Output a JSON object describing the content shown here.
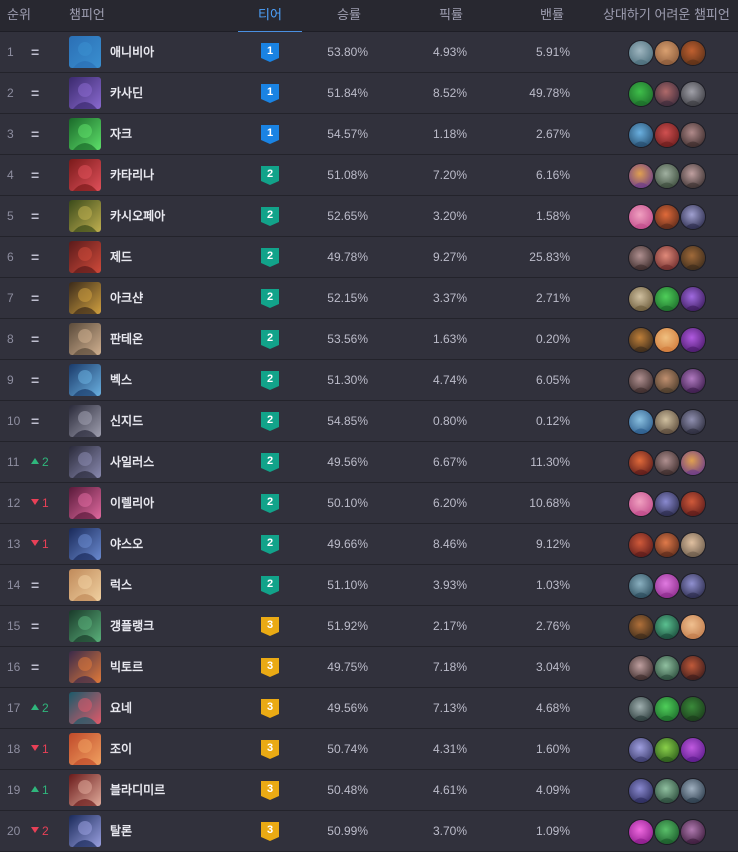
{
  "header": {
    "rank": "순위",
    "champion": "챔피언",
    "tier": "티어",
    "win_rate": "승률",
    "pick_rate": "픽률",
    "ban_rate": "밴률",
    "counters": "상대하기 어려운 챔피언"
  },
  "colors": {
    "tier1": "#1a83e3",
    "tier2": "#12a38a",
    "tier3": "#eaaa14",
    "up": "#2fb67c",
    "down": "#e84057",
    "active_tab": "#4a90e2"
  },
  "rows": [
    {
      "rank": "1",
      "change_dir": "same",
      "change": "=",
      "name": "애니비아",
      "tier": "1",
      "win": "53.80%",
      "pick": "4.93%",
      "ban": "5.91%",
      "c": [
        "#2b6fb5",
        "#3a8fd0"
      ],
      "counters": [
        [
          "#4a6c7a",
          "#9fb6c0"
        ],
        [
          "#8a5a3a",
          "#d9a070"
        ],
        [
          "#5a3018",
          "#c06030"
        ]
      ]
    },
    {
      "rank": "2",
      "change_dir": "same",
      "change": "=",
      "name": "카사딘",
      "tier": "1",
      "win": "51.84%",
      "pick": "8.52%",
      "ban": "49.78%",
      "c": [
        "#3b2a6e",
        "#8a6ad0"
      ],
      "counters": [
        [
          "#1c6a2a",
          "#3fbf4a"
        ],
        [
          "#3a2a3a",
          "#b06a6a"
        ],
        [
          "#3a3a40",
          "#a0a0a8"
        ]
      ]
    },
    {
      "rank": "3",
      "change_dir": "same",
      "change": "=",
      "name": "자크",
      "tier": "1",
      "win": "54.57%",
      "pick": "1.18%",
      "ban": "2.67%",
      "c": [
        "#1a6a2a",
        "#5ee06a"
      ],
      "counters": [
        [
          "#244a6a",
          "#6ab0e0"
        ],
        [
          "#6a1c1c",
          "#d05050"
        ],
        [
          "#3a2a2a",
          "#b08a8a"
        ]
      ]
    },
    {
      "rank": "4",
      "change_dir": "same",
      "change": "=",
      "name": "카타리나",
      "tier": "2",
      "win": "51.08%",
      "pick": "7.20%",
      "ban": "6.16%",
      "c": [
        "#7a1a1a",
        "#e0505a"
      ],
      "counters": [
        [
          "#6a3a8a",
          "#e0a050"
        ],
        [
          "#3a4a3a",
          "#a0b0a0"
        ],
        [
          "#3a3030",
          "#c0a0a0"
        ]
      ]
    },
    {
      "rank": "5",
      "change_dir": "same",
      "change": "=",
      "name": "카시오페아",
      "tier": "2",
      "win": "52.65%",
      "pick": "3.20%",
      "ban": "1.58%",
      "c": [
        "#3a4a1a",
        "#c0b050"
      ],
      "counters": [
        [
          "#c04a8a",
          "#f0a0c0"
        ],
        [
          "#5a2a1a",
          "#e06a3a"
        ],
        [
          "#2a2a4a",
          "#a0a0d0"
        ]
      ]
    },
    {
      "rank": "6",
      "change_dir": "same",
      "change": "=",
      "name": "제드",
      "tier": "2",
      "win": "49.78%",
      "pick": "9.27%",
      "ban": "25.83%",
      "c": [
        "#5a1a1a",
        "#d04a3a"
      ],
      "counters": [
        [
          "#3a2a2a",
          "#b09090"
        ],
        [
          "#6a2a2a",
          "#e08a7a"
        ],
        [
          "#3a2a1a",
          "#a06a3a"
        ]
      ]
    },
    {
      "rank": "7",
      "change_dir": "same",
      "change": "=",
      "name": "아크샨",
      "tier": "2",
      "win": "52.15%",
      "pick": "3.37%",
      "ban": "2.71%",
      "c": [
        "#3a2a1a",
        "#d0a040"
      ],
      "counters": [
        [
          "#6a5a3a",
          "#d0c0a0"
        ],
        [
          "#1c6a2a",
          "#4fcf5a"
        ],
        [
          "#3a1a5a",
          "#a06ae0"
        ]
      ]
    },
    {
      "rank": "8",
      "change_dir": "same",
      "change": "=",
      "name": "판테온",
      "tier": "2",
      "win": "53.56%",
      "pick": "1.63%",
      "ban": "0.20%",
      "c": [
        "#5a4a3a",
        "#d0b090"
      ],
      "counters": [
        [
          "#3a2a1a",
          "#c0803a"
        ],
        [
          "#d07a3a",
          "#f0c080"
        ],
        [
          "#4a1a6a",
          "#b05ae0"
        ]
      ]
    },
    {
      "rank": "9",
      "change_dir": "same",
      "change": "=",
      "name": "벡스",
      "tier": "2",
      "win": "51.30%",
      "pick": "4.74%",
      "ban": "6.05%",
      "c": [
        "#1a3a6a",
        "#6ab0e0"
      ],
      "counters": [
        [
          "#3a2a2a",
          "#b09090"
        ],
        [
          "#4a3a2a",
          "#c09070"
        ],
        [
          "#3a1a4a",
          "#b07ac0"
        ]
      ]
    },
    {
      "rank": "10",
      "change_dir": "same",
      "change": "=",
      "name": "신지드",
      "tier": "2",
      "win": "54.85%",
      "pick": "0.80%",
      "ban": "0.12%",
      "c": [
        "#2a2a3a",
        "#a0a0b0"
      ],
      "counters": [
        [
          "#2a5a8a",
          "#8ac0e0"
        ],
        [
          "#5a4a3a",
          "#d0c0a0"
        ],
        [
          "#2a2a3a",
          "#9090b0"
        ]
      ]
    },
    {
      "rank": "11",
      "change_dir": "up",
      "change": "2",
      "name": "사일러스",
      "tier": "2",
      "win": "49.56%",
      "pick": "6.67%",
      "ban": "11.30%",
      "c": [
        "#2a2a3a",
        "#8a8ab0"
      ],
      "counters": [
        [
          "#5a1a1a",
          "#e06a3a"
        ],
        [
          "#3a2a2a",
          "#b09090"
        ],
        [
          "#6a3a8a",
          "#e0a050"
        ]
      ]
    },
    {
      "rank": "12",
      "change_dir": "down",
      "change": "1",
      "name": "이렐리아",
      "tier": "2",
      "win": "50.10%",
      "pick": "6.20%",
      "ban": "10.68%",
      "c": [
        "#5a1a3a",
        "#e06aa0"
      ],
      "counters": [
        [
          "#c04a8a",
          "#f0a0c0"
        ],
        [
          "#2a2a4a",
          "#8a8ad0"
        ],
        [
          "#5a1a1a",
          "#d05a3a"
        ]
      ]
    },
    {
      "rank": "13",
      "change_dir": "down",
      "change": "1",
      "name": "야스오",
      "tier": "2",
      "win": "49.66%",
      "pick": "8.46%",
      "ban": "9.12%",
      "c": [
        "#1a2a5a",
        "#6a8ad0"
      ],
      "counters": [
        [
          "#5a1a1a",
          "#d05a3a"
        ],
        [
          "#5a2a1a",
          "#e07a4a"
        ],
        [
          "#6a5a4a",
          "#e0c0a0"
        ]
      ]
    },
    {
      "rank": "14",
      "change_dir": "same",
      "change": "=",
      "name": "럭스",
      "tier": "2",
      "win": "51.10%",
      "pick": "3.93%",
      "ban": "1.03%",
      "c": [
        "#c08a5a",
        "#f0d0a0"
      ],
      "counters": [
        [
          "#2a4a5a",
          "#8ab0c0"
        ],
        [
          "#8a2a8a",
          "#e07ae0"
        ],
        [
          "#2a2a4a",
          "#9090d0"
        ]
      ]
    },
    {
      "rank": "15",
      "change_dir": "same",
      "change": "=",
      "name": "갱플랭크",
      "tier": "3",
      "win": "51.92%",
      "pick": "2.17%",
      "ban": "2.76%",
      "c": [
        "#1a3a2a",
        "#5ab07a"
      ],
      "counters": [
        [
          "#3a2a1a",
          "#b0703a"
        ],
        [
          "#1a4a3a",
          "#5ac090"
        ],
        [
          "#c07a4a",
          "#f0c090"
        ]
      ]
    },
    {
      "rank": "16",
      "change_dir": "same",
      "change": "=",
      "name": "빅토르",
      "tier": "3",
      "win": "49.75%",
      "pick": "7.18%",
      "ban": "3.04%",
      "c": [
        "#3a2a4a",
        "#e07a3a"
      ],
      "counters": [
        [
          "#3a2a2a",
          "#c0a0a0"
        ],
        [
          "#2a4a3a",
          "#90c0a0"
        ],
        [
          "#3a1a1a",
          "#c05a3a"
        ]
      ]
    },
    {
      "rank": "17",
      "change_dir": "up",
      "change": "2",
      "name": "요네",
      "tier": "3",
      "win": "49.56%",
      "pick": "7.13%",
      "ban": "4.68%",
      "c": [
        "#1a5a6a",
        "#e05a6a"
      ],
      "counters": [
        [
          "#2a3a3a",
          "#a0b0b0"
        ],
        [
          "#1c6a2a",
          "#4fcf5a"
        ],
        [
          "#1a3a1a",
          "#3a8a3a"
        ]
      ]
    },
    {
      "rank": "18",
      "change_dir": "down",
      "change": "1",
      "name": "조이",
      "tier": "3",
      "win": "50.74%",
      "pick": "4.31%",
      "ban": "1.60%",
      "c": [
        "#c04a2a",
        "#f0a060"
      ],
      "counters": [
        [
          "#3a3a6a",
          "#a0a0e0"
        ],
        [
          "#2a5a1a",
          "#8ad04a"
        ],
        [
          "#5a1a8a",
          "#c05ae0"
        ]
      ]
    },
    {
      "rank": "19",
      "change_dir": "up",
      "change": "1",
      "name": "블라디미르",
      "tier": "3",
      "win": "50.48%",
      "pick": "4.61%",
      "ban": "4.09%",
      "c": [
        "#6a1a1a",
        "#e0aa9a"
      ],
      "counters": [
        [
          "#2a2a5a",
          "#8a8ad0"
        ],
        [
          "#2a4a3a",
          "#90c0a0"
        ],
        [
          "#2a3a4a",
          "#a0b0c0"
        ]
      ]
    },
    {
      "rank": "20",
      "change_dir": "down",
      "change": "2",
      "name": "탈론",
      "tier": "3",
      "win": "50.99%",
      "pick": "3.70%",
      "ban": "1.09%",
      "c": [
        "#1a2a5a",
        "#9aa0e0"
      ],
      "counters": [
        [
          "#8a1a8a",
          "#f06ae0"
        ],
        [
          "#1a5a2a",
          "#5ac06a"
        ],
        [
          "#3a1a3a",
          "#b07ab0"
        ]
      ]
    }
  ]
}
